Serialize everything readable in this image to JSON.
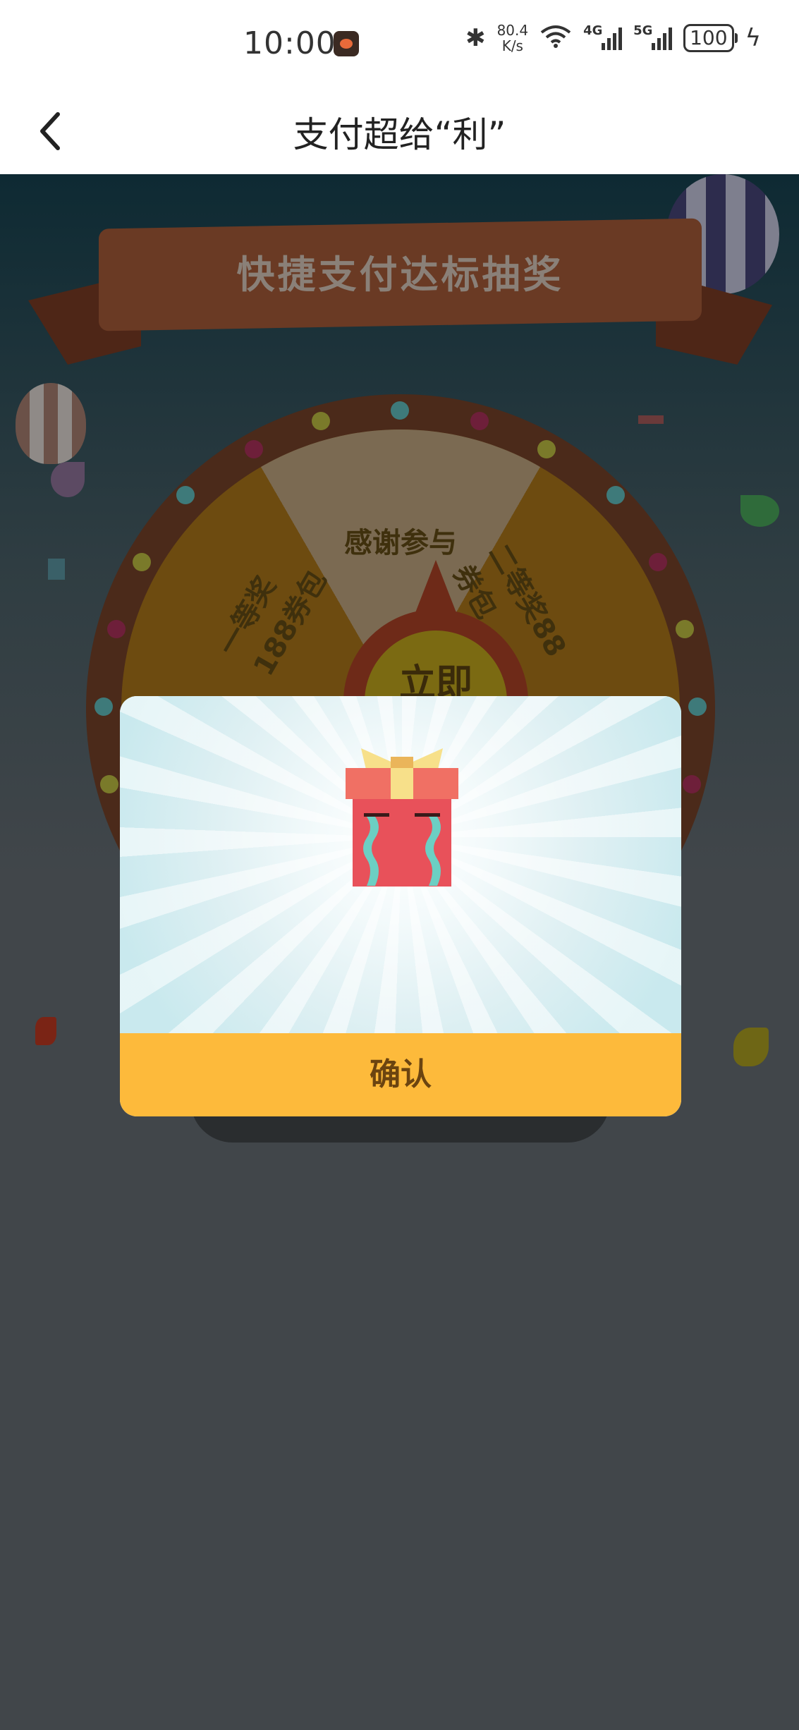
{
  "status_bar": {
    "time": "10:00",
    "speed_value": "80.4",
    "speed_unit": "K/s",
    "net1": "4G",
    "net2": "5G",
    "battery": "100"
  },
  "header": {
    "title": "支付超给“利”"
  },
  "wheel": {
    "banner_title": "快捷支付达标抽奖",
    "prize_top": "感谢参与",
    "prize_left": "一等奖188券包",
    "prize_right": "二等奖88券包",
    "center_label": "立即"
  },
  "modal": {
    "confirm_label": "确认"
  },
  "colors": {
    "confirm_bg": "#fdba3b",
    "confirm_text": "#6b4410",
    "gift_red": "#e8515a",
    "ribbon_yellow": "#f7e08a"
  }
}
